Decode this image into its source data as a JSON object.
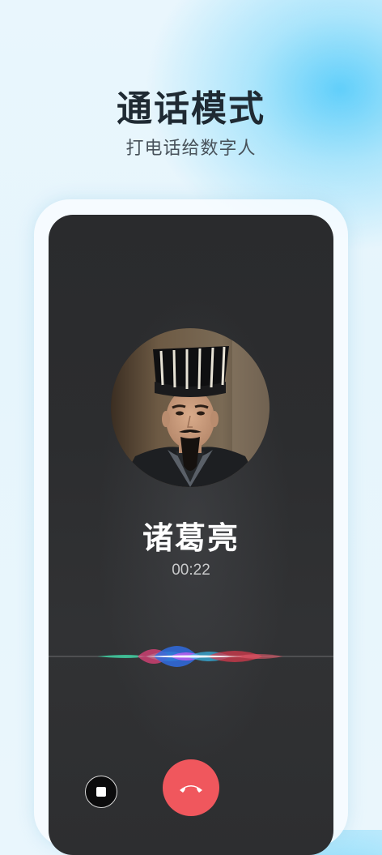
{
  "header": {
    "title": "通话模式",
    "subtitle": "打电话给数字人"
  },
  "call": {
    "contact_name": "诸葛亮",
    "timer": "00:22",
    "avatar_icon": "zhuge-liang-portrait",
    "stop_icon": "stop-icon",
    "hangup_icon": "phone-hangup-icon"
  },
  "colors": {
    "screen_bg": "#2c2d2f",
    "hangup_red": "#f0575d",
    "title_text": "#1f2a33"
  }
}
